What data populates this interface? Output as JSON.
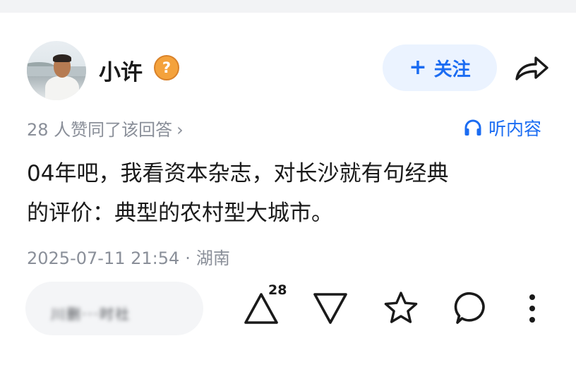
{
  "author": {
    "name": "小许",
    "badge_symbol": "?"
  },
  "follow_button": {
    "plus": "+",
    "label": "关注"
  },
  "likes_summary": {
    "text": "28 人赞同了该回答",
    "chevron": "›"
  },
  "listen": {
    "label": "听内容"
  },
  "answer": {
    "lines": [
      "04年吧，我看资本杂志，对长沙就有句经典",
      "的评价：典型的农村型大城市。"
    ]
  },
  "meta": {
    "datetime": "2025-07-11 21:54",
    "separator": "·",
    "location": "湖南"
  },
  "comment_box": {
    "placeholder_blurred": "川删···时社"
  },
  "actions": {
    "upvote_count": "28"
  },
  "icons": [
    "share-icon",
    "headphones-icon",
    "upvote-icon",
    "downvote-icon",
    "star-icon",
    "comment-icon",
    "more-icon"
  ],
  "colors": {
    "accent": "#1b6cf2",
    "follow_bg": "#ebf3ff",
    "meta_gray": "#8a8f99",
    "badge_orange": "#f4a23c"
  }
}
